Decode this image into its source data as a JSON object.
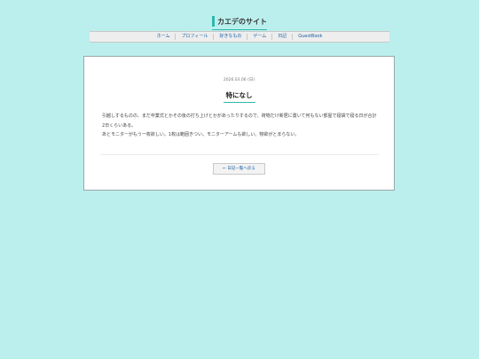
{
  "site": {
    "title": "カエデのサイト"
  },
  "nav": {
    "items": [
      "ホーム",
      "プロフィール",
      "好きなもの",
      "ゲーム",
      "日記",
      "GuestBook"
    ]
  },
  "post": {
    "date": "2026.03.06 (日)",
    "title": "特になし",
    "paragraphs": [
      "引越しするものの、まだ卒業式とかその後の打ち上げとかがあったりするので、荷物だけ新居に置いて何もない部屋で寝袋で寝る日が合計2日くらいある。",
      "あとモニターがもう一枚欲しい。1枚は範囲きつい。モニターアームも欲しい。物欲がとまらない。"
    ]
  },
  "back_button": {
    "label": "← 日記一覧へ戻る"
  },
  "colors": {
    "background": "#bbefed",
    "accent": "#2fb7ae",
    "link": "#1a5fa0"
  }
}
